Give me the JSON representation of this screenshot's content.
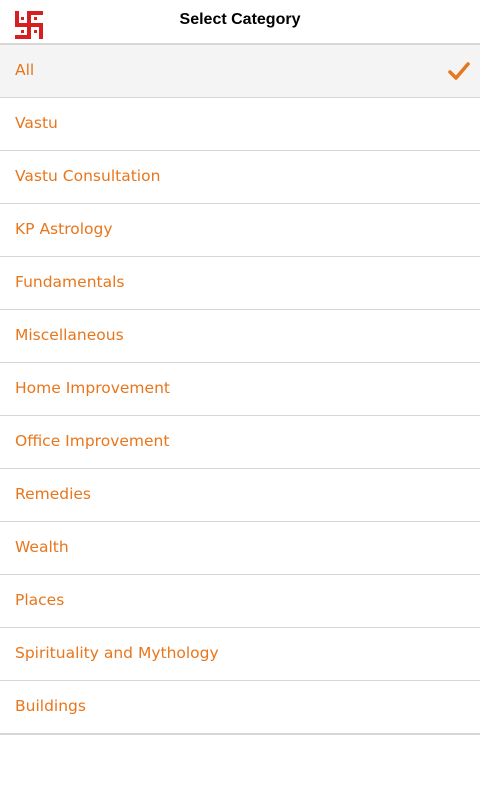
{
  "header": {
    "title": "Select Category",
    "logo_icon": "swastika-icon",
    "logo_color": "#d61f1f"
  },
  "categories": {
    "accent_color": "#e8761c",
    "selected_index": 0,
    "items": [
      {
        "label": "All"
      },
      {
        "label": "Vastu"
      },
      {
        "label": "Vastu Consultation"
      },
      {
        "label": "KP Astrology"
      },
      {
        "label": "Fundamentals"
      },
      {
        "label": "Miscellaneous"
      },
      {
        "label": "Home Improvement"
      },
      {
        "label": "Office Improvement"
      },
      {
        "label": "Remedies"
      },
      {
        "label": "Wealth"
      },
      {
        "label": "Places"
      },
      {
        "label": "Spirituality and Mythology"
      },
      {
        "label": "Buildings"
      }
    ]
  }
}
